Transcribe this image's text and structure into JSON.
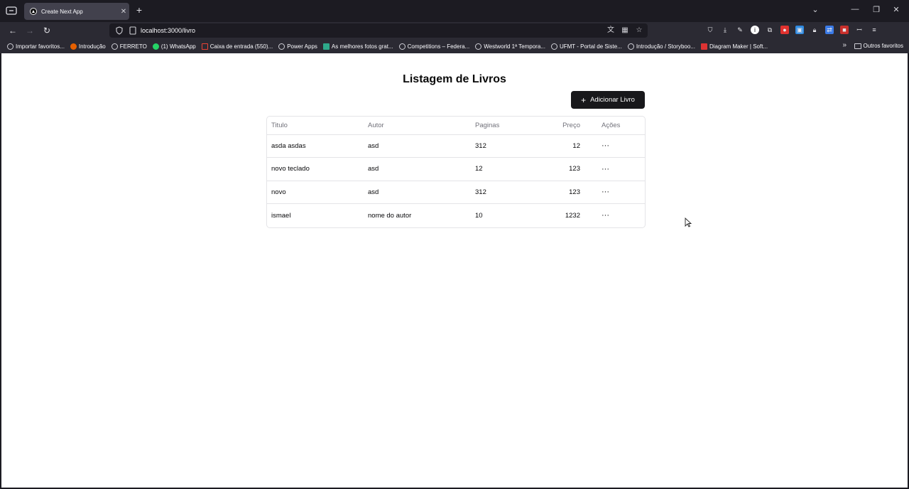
{
  "browser": {
    "tab_title": "Create Next App",
    "url": "localhost:3000/livro",
    "bookmarks": [
      {
        "label": "Importar favoritos...",
        "icon": "import-icon"
      },
      {
        "label": "Introdução",
        "icon": "firefox-icon"
      },
      {
        "label": "FERRETO",
        "icon": "globe-icon"
      },
      {
        "label": "(1) WhatsApp",
        "icon": "whatsapp-icon"
      },
      {
        "label": "Caixa de entrada (550)...",
        "icon": "gmail-icon"
      },
      {
        "label": "Power Apps",
        "icon": "globe-icon"
      },
      {
        "label": "As melhores fotos grat...",
        "icon": "photo-icon"
      },
      {
        "label": "Competitions – Federa...",
        "icon": "globe-icon"
      },
      {
        "label": "Westworld 1ª Tempora...",
        "icon": "globe-icon"
      },
      {
        "label": "UFMT - Portal de Siste...",
        "icon": "globe-icon"
      },
      {
        "label": "Introdução / Storyboo...",
        "icon": "globe-icon"
      },
      {
        "label": "Diagram Maker | Soft...",
        "icon": "diagram-icon"
      }
    ],
    "other_bookmarks": "Outros favoritos"
  },
  "page": {
    "title": "Listagem de Livros",
    "add_button": "Adicionar Livro",
    "table": {
      "headers": {
        "title": "Titulo",
        "author": "Autor",
        "pages": "Paginas",
        "price": "Preço",
        "actions": "Ações"
      },
      "rows": [
        {
          "title": "asda asdas",
          "author": "asd",
          "pages": "312",
          "price": "12",
          "actions": "···"
        },
        {
          "title": "novo teclado",
          "author": "asd",
          "pages": "12",
          "price": "123",
          "actions": "···"
        },
        {
          "title": "novo",
          "author": "asd",
          "pages": "312",
          "price": "123",
          "actions": "···"
        },
        {
          "title": "ismael",
          "author": "nome do autor",
          "pages": "10",
          "price": "1232",
          "actions": "···"
        }
      ]
    }
  },
  "colors": {
    "chrome_bg": "#1c1b22",
    "toolbar_bg": "#2b2a33",
    "button_bg": "#18181b",
    "border": "#e4e4e7",
    "muted_text": "#71717a"
  }
}
